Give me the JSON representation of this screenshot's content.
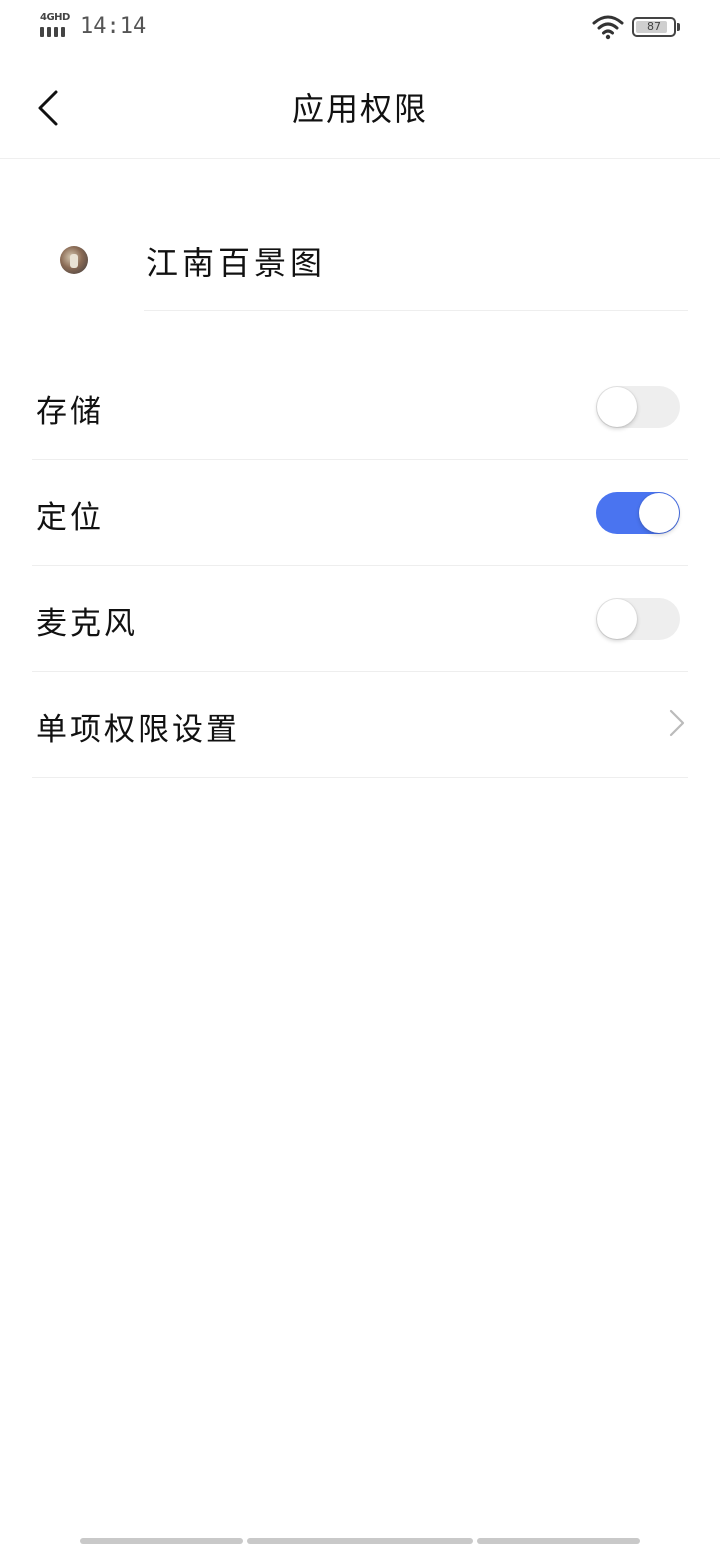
{
  "status_bar": {
    "network": "4GHD",
    "time": "14:14",
    "battery_level": "87",
    "battery_percent": 87
  },
  "header": {
    "title": "应用权限",
    "back_icon": "chevron-left-icon"
  },
  "app": {
    "name": "江南百景图",
    "icon": "app-avatar-icon"
  },
  "permissions": [
    {
      "label": "存储",
      "enabled": false
    },
    {
      "label": "定位",
      "enabled": true
    },
    {
      "label": "麦克风",
      "enabled": false
    }
  ],
  "detail_settings": {
    "label": "单项权限设置",
    "icon": "chevron-right-icon"
  },
  "colors": {
    "accent": "#4a74f0",
    "toggle_off": "#eeeeee",
    "divider": "#eeeeee"
  }
}
